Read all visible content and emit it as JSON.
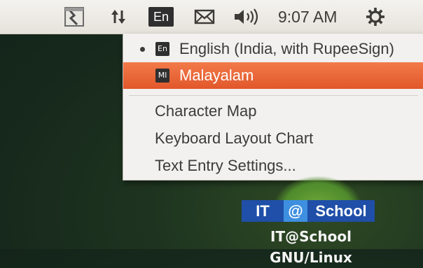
{
  "panel": {
    "keyboard_indicator": "En",
    "clock": "9:07 AM",
    "icons": [
      "screenshot-app-icon",
      "network-updown-icon",
      "keyboard-indicator-icon",
      "mail-envelope-icon",
      "volume-speaker-icon",
      "power-settings-icon"
    ]
  },
  "menu": {
    "items": [
      {
        "label": "English (India, with RupeeSign)",
        "icon": "En",
        "selected": true
      },
      {
        "label": "Malayalam",
        "icon": "Ml",
        "highlighted": true
      },
      {
        "label": "Character Map"
      },
      {
        "label": "Keyboard Layout Chart"
      },
      {
        "label": "Text Entry Settings..."
      }
    ]
  },
  "branding": {
    "logo_it": "IT",
    "logo_at": "@",
    "logo_school": "School",
    "caption": "IT@School GNU/Linux"
  },
  "colors": {
    "panel_bg": "#ece9e4",
    "highlight": "#e9663a",
    "desktop": "#1a2e1e",
    "logo_blue": "#1f4fa8"
  }
}
